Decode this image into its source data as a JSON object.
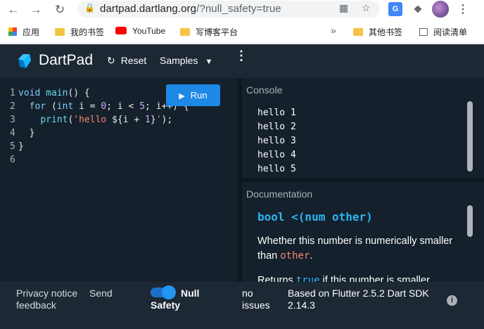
{
  "browser": {
    "url_host": "dartpad.dartlang.org",
    "url_rest": "/?null_safety=true",
    "bookmarks": [
      {
        "label": "应用",
        "icon": "apps-grid-icon"
      },
      {
        "label": "我的书签",
        "icon": "folder-icon"
      },
      {
        "label": "YouTube",
        "icon": "youtube-icon"
      },
      {
        "label": "写博客平台",
        "icon": "folder-icon"
      }
    ],
    "other_bookmarks": "其他书签",
    "reading_list": "阅读清单"
  },
  "dartpad": {
    "title": "DartPad",
    "reset_label": "Reset",
    "samples_label": "Samples",
    "run_label": "Run",
    "code_lines": [
      "1",
      "2",
      "3",
      "4",
      "5",
      "6"
    ],
    "code": {
      "l1_void": "void ",
      "l1_main": "main",
      "l1_rest": "() {",
      "l2_indent": "  ",
      "l2_for": "for",
      "l2_open": " (",
      "l2_int": "int",
      "l2_i1": " i = ",
      "l2_zero": "0",
      "l2_semi1": "; i < ",
      "l2_five": "5",
      "l2_tail": "; i++) {",
      "l3_indent": "    ",
      "l3_print": "print",
      "l3_open": "(",
      "l3_str1": "'hello ",
      "l3_interp": "${i + ",
      "l3_one": "1",
      "l3_close_interp": "}",
      "l3_str2": "'",
      "l3_end": ");",
      "l4": "  }",
      "l5": "}",
      "l6": ""
    },
    "console_title": "Console",
    "console_output": [
      "hello 1",
      "hello 2",
      "hello 3",
      "hello 4",
      "hello 5"
    ],
    "doc_title": "Documentation",
    "doc_signature": "bool <(num other)",
    "doc_text_a": "Whether this number is numerically smaller than ",
    "doc_text_code": "other",
    "doc_text_b": ".",
    "doc_text2_a": "Returns ",
    "doc_text2_code": "true",
    "doc_text2_b": " if this number is smaller"
  },
  "footer": {
    "privacy": "Privacy notice",
    "send_feedback_1": "Send",
    "feedback": "feedback",
    "null_safety_1": "Null",
    "null_safety_2": "Safety",
    "issues_1": "no",
    "issues_2": "issues",
    "version_1": "Based on Flutter 2.5.2 Dart SDK",
    "version_2": "2.14.3",
    "null_safety_on": true
  },
  "colors": {
    "header_bg": "#1c2834",
    "editor_bg": "#14202b",
    "run_button": "#1e88e5",
    "doc_signature": "#2ab4f2",
    "string": "#f48771"
  }
}
